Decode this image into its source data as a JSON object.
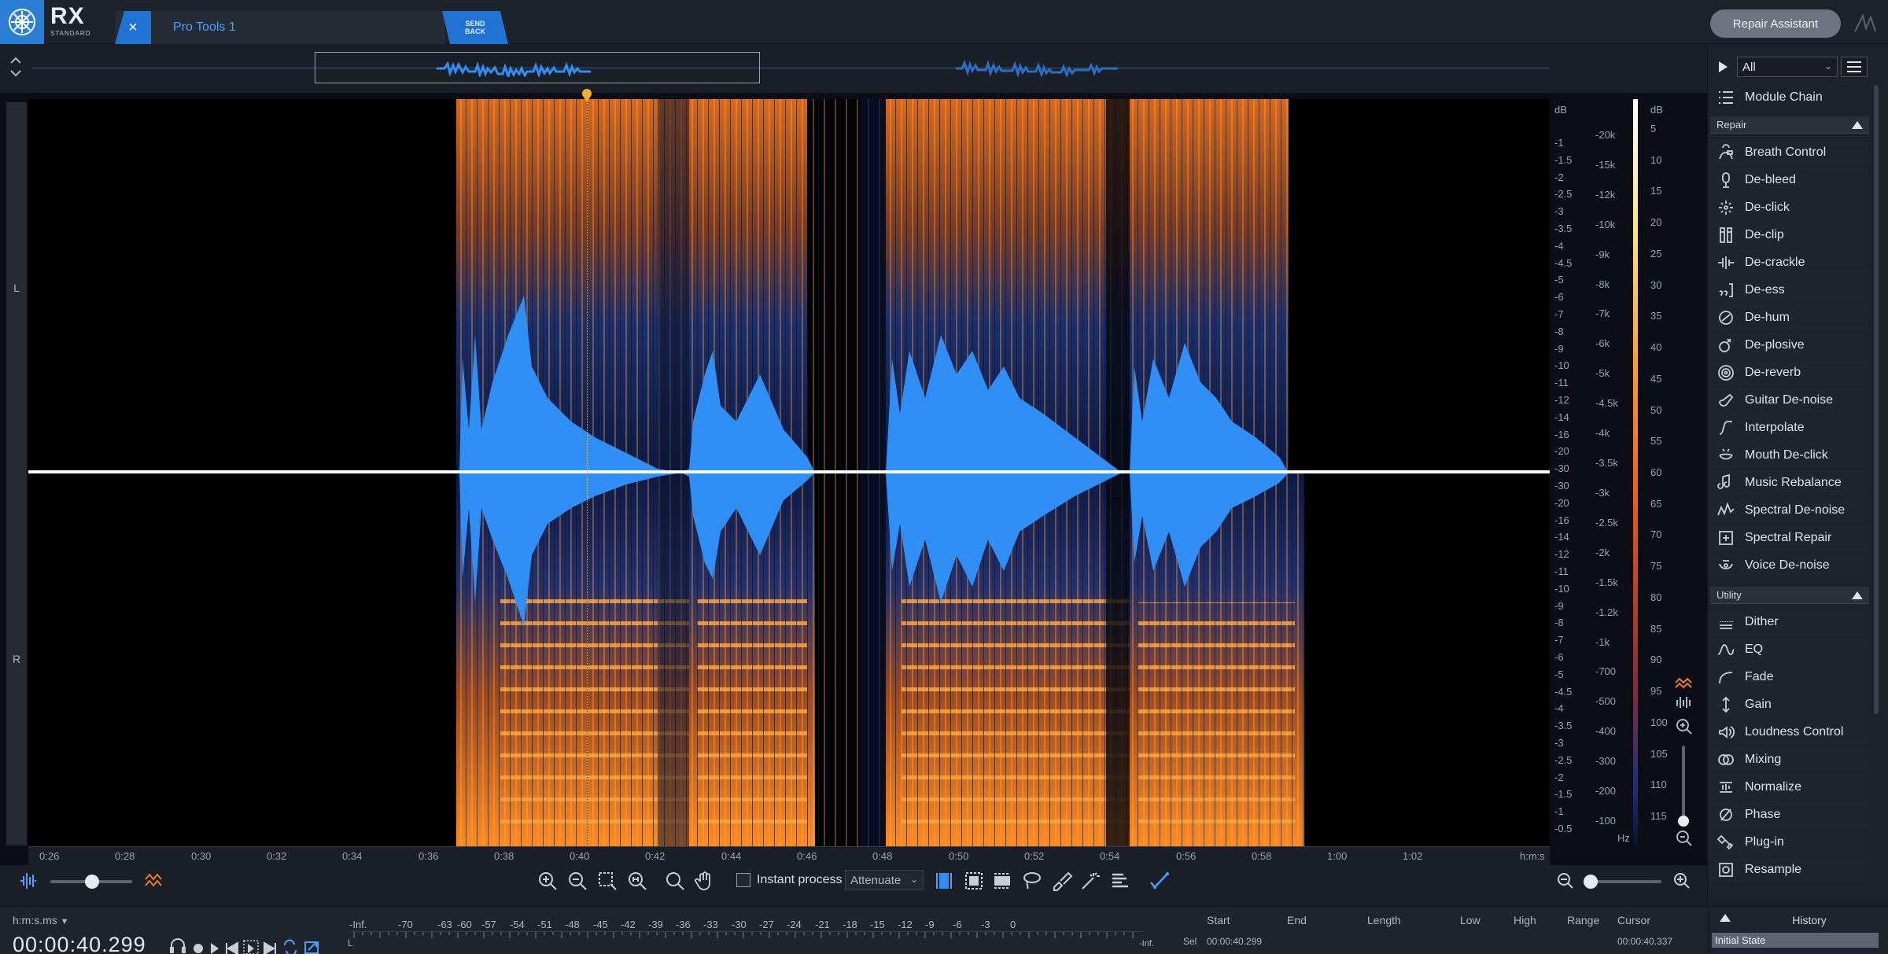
{
  "app": {
    "brand": "RX",
    "edition": "STANDARD",
    "tab_title": "Pro Tools 1",
    "tab_close": "×",
    "send_back": "SEND BACK",
    "repair_assistant": "Repair Assistant"
  },
  "channels": {
    "left": "L",
    "right": "R"
  },
  "scales": {
    "db_title": "dB",
    "db_ticks": [
      "-1",
      "-1.5",
      "-2",
      "-2.5",
      "-3",
      "-3.5",
      "-4",
      "-4.5",
      "-5",
      "-6",
      "-7",
      "-8",
      "-9",
      "-10",
      "-11",
      "-12",
      "-14",
      "-16",
      "-20",
      "-30",
      "-30",
      "-20",
      "-16",
      "-14",
      "-12",
      "-11",
      "-10",
      "-9",
      "-8",
      "-7",
      "-6",
      "-5",
      "-4.5",
      "-4",
      "-3.5",
      "-3",
      "-2.5",
      "-2",
      "-1.5",
      "-1",
      "-0.5"
    ],
    "hz_ticks": [
      "-20k",
      "-15k",
      "-12k",
      "-10k",
      "-9k",
      "-8k",
      "-7k",
      "-6k",
      "-5k",
      "-4.5k",
      "-4k",
      "-3.5k",
      "-3k",
      "-2.5k",
      "-2k",
      "-1.5k",
      "-1.2k",
      "-1k",
      "-700",
      "-500",
      "-400",
      "-300",
      "-200",
      "-100"
    ],
    "hz_unit": "Hz",
    "color_db_title": "dB",
    "color_db_ticks": [
      "5",
      "10",
      "15",
      "20",
      "25",
      "30",
      "35",
      "40",
      "45",
      "50",
      "55",
      "60",
      "65",
      "70",
      "75",
      "80",
      "85",
      "90",
      "95",
      "100",
      "105",
      "110",
      "115"
    ]
  },
  "time_ruler": {
    "ticks": [
      "0:26",
      "0:28",
      "0:30",
      "0:32",
      "0:34",
      "0:36",
      "0:38",
      "0:40",
      "0:42",
      "0:44",
      "0:46",
      "0:48",
      "0:50",
      "0:52",
      "0:54",
      "0:56",
      "0:58",
      "1:00",
      "1:02"
    ],
    "unit": "h:m:s"
  },
  "toolbar": {
    "instant_process": "Instant process",
    "attenuate": "Attenuate"
  },
  "status": {
    "time_format": "h:m:s.ms",
    "timecode": "00:00:40.299",
    "meter_labels": [
      "-Inf.",
      "-70",
      "-63",
      "-60",
      "-57",
      "-54",
      "-51",
      "-48",
      "-45",
      "-42",
      "-39",
      "-36",
      "-33",
      "-30",
      "-27",
      "-24",
      "-21",
      "-18",
      "-15",
      "-12",
      "-9",
      "-6",
      "-3",
      "0"
    ],
    "meter_channel": "L",
    "meter_inf": "-Inf.",
    "sel_headers": [
      "Start",
      "End",
      "Length",
      "Low",
      "High",
      "Range",
      "Cursor"
    ],
    "sel_label": "Sel",
    "sel_start": "00:00:40.299",
    "cursor": "00:00:40.337"
  },
  "panel": {
    "filter": "All",
    "module_chain": "Module Chain",
    "repair_section": "Repair",
    "repair_items": [
      "Breath Control",
      "De-bleed",
      "De-click",
      "De-clip",
      "De-crackle",
      "De-ess",
      "De-hum",
      "De-plosive",
      "De-reverb",
      "Guitar De-noise",
      "Interpolate",
      "Mouth De-click",
      "Music Rebalance",
      "Spectral De-noise",
      "Spectral Repair",
      "Voice De-noise"
    ],
    "utility_section": "Utility",
    "utility_items": [
      "Dither",
      "EQ",
      "Fade",
      "Gain",
      "Loudness Control",
      "Mixing",
      "Normalize",
      "Phase",
      "Plug-in",
      "Resample"
    ],
    "history_title": "History",
    "history_item": "Initial State"
  },
  "colors": {
    "accent": "#1f73d3",
    "waveform": "#2f8ff5",
    "spectrum": "#ff8a1f"
  }
}
